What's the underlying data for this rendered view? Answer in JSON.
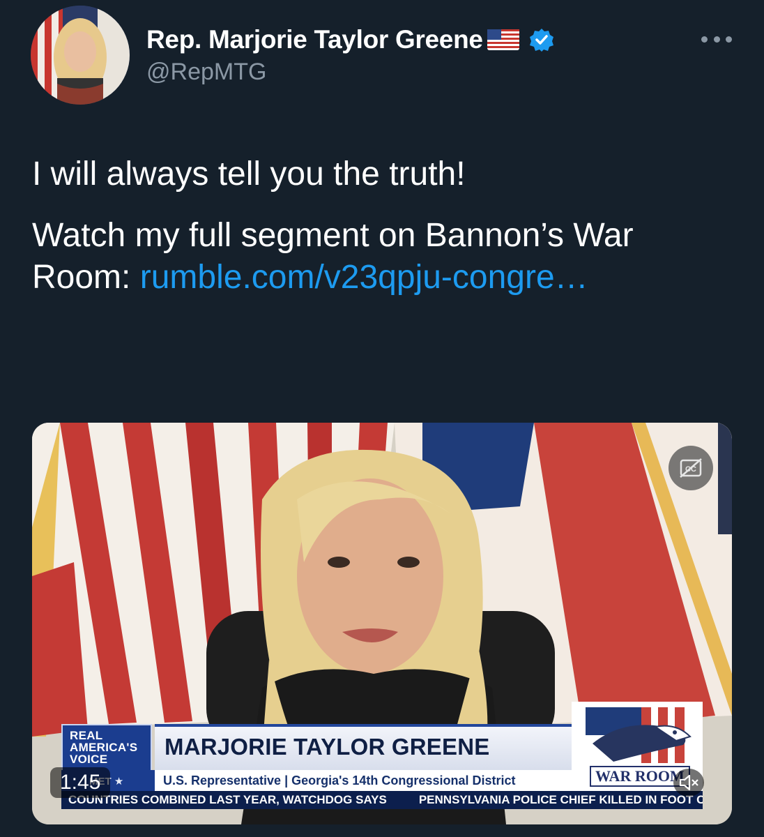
{
  "author": {
    "display_name": "Rep. Marjorie Taylor Greene",
    "handle": "@RepMTG",
    "flag_icon": "us-flag-emoji",
    "verified_icon": "verified-badge-icon"
  },
  "menu": {
    "more_icon": "more-horizontal-icon"
  },
  "tweet": {
    "line1": "I will always tell you the truth!",
    "line2_prefix": "Watch my full segment on Bannon’s War Room: ",
    "link": "rumble.com/v23qpju-congre…"
  },
  "video": {
    "duration": "1:45",
    "chyron_logo": [
      "REAL",
      "AMERICA'S",
      "VOICE"
    ],
    "chyron_left_sub": "MET ★",
    "chyron_name": "MARJORIE TAYLOR GREENE",
    "chyron_subtitle": "U.S. Representative | Georgia's 14th Congressional District",
    "war_room_label": "WAR ROOM",
    "ticker_1": "COUNTRIES COMBINED LAST YEAR, WATCHDOG SAYS",
    "ticker_2": "PENNSYLVANIA POLICE CHIEF KILLED IN FOOT CHA",
    "cc_icon": "closed-captions-off-icon",
    "mute_icon": "muted-speaker-icon"
  },
  "colors": {
    "background": "#15202b",
    "link": "#1d9bf0",
    "secondary_text": "#8b98a5"
  }
}
